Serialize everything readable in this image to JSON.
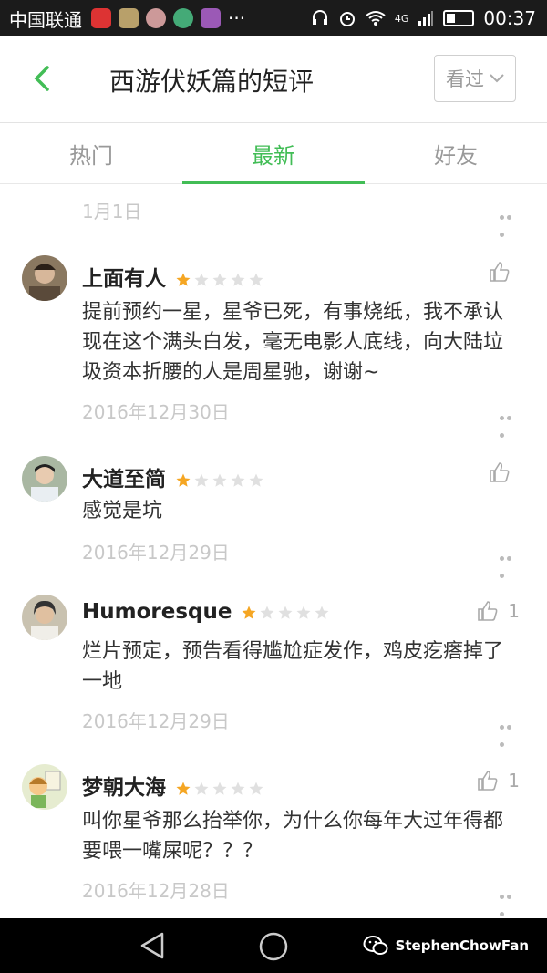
{
  "status": {
    "carrier": "中国联通",
    "net": "4G",
    "time": "00:37",
    "battery_level": 0.4
  },
  "header": {
    "title": "西游伏妖篇的短评",
    "seen_label": "看过"
  },
  "tabs": [
    {
      "label": "热门",
      "active": false
    },
    {
      "label": "最新",
      "active": true
    },
    {
      "label": "好友",
      "active": false
    }
  ],
  "top_date": "1月1日",
  "comments": [
    {
      "name": "上面有人",
      "rating": 1,
      "likes": "",
      "text": "提前预约一星，星爷已死，有事烧纸，我不承认现在这个满头白发，毫无电影人底线，向大陆垃圾资本折腰的人是周星驰，谢谢~",
      "date": "2016年12月30日"
    },
    {
      "name": "大道至简",
      "rating": 1,
      "likes": "",
      "text": "感觉是坑",
      "date": "2016年12月29日"
    },
    {
      "name": "Humoresque",
      "rating": 1,
      "likes": "1",
      "text": "烂片预定，预告看得尴尬症发作，鸡皮疙瘩掉了一地",
      "date": "2016年12月29日"
    },
    {
      "name": "梦朝大海",
      "rating": 1,
      "likes": "1",
      "text": "叫你星爷那么抬举你，为什么你每年大过年得都要喂一嘴屎呢？？？",
      "date": "2016年12月28日"
    }
  ],
  "watermark": "StephenChowFan",
  "colors": {
    "accent": "#42bd56",
    "star": "#f5a623",
    "star_empty": "#e0e0e0"
  }
}
